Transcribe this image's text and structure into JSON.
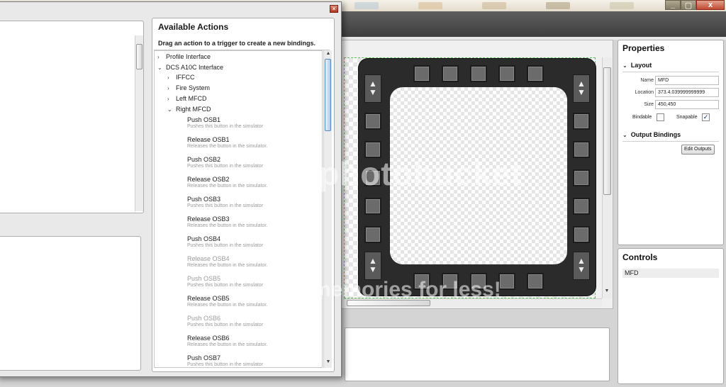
{
  "window": {
    "controls": [
      "_",
      "▢",
      "x"
    ]
  },
  "available_actions": {
    "title": "Available Actions",
    "hint": "Drag an action to a trigger to create a new bindings.",
    "tree": [
      {
        "label": "Profile Interface",
        "expanded": false
      },
      {
        "label": "DCS A10C Interface",
        "expanded": true
      },
      {
        "label": "IFFCC",
        "expanded": false
      },
      {
        "label": "Fire System",
        "expanded": false
      },
      {
        "label": "Left MFCD",
        "expanded": false
      },
      {
        "label": "Right MFCD",
        "expanded": true
      }
    ],
    "actions": [
      {
        "name": "Push OSB1",
        "desc": "Pushes this button in the simulator"
      },
      {
        "name": "Release OSB1",
        "desc": "Releases the button in the simulator."
      },
      {
        "name": "Push OSB2",
        "desc": "Pushes this button in the simulator"
      },
      {
        "name": "Release OSB2",
        "desc": "Releases the button in the simulator."
      },
      {
        "name": "Push OSB3",
        "desc": "Pushes this button in the simulator"
      },
      {
        "name": "Release OSB3",
        "desc": "Releases the button in the simulator."
      },
      {
        "name": "Push OSB4",
        "desc": "Pushes this button in the simulator"
      },
      {
        "name": "Release OSB4",
        "desc": "Releases the button in the simulator."
      },
      {
        "name": "Push OSB5",
        "desc": "Pushes this button in the simulator"
      },
      {
        "name": "Release OSB5",
        "desc": "Releases the button in the simulator."
      },
      {
        "name": "Push OSB6",
        "desc": "Pushes this button in the simulator"
      },
      {
        "name": "Release OSB6",
        "desc": "Releases the button in the simulator."
      },
      {
        "name": "Push OSB7",
        "desc": "Pushes this button in the simulator"
      }
    ]
  },
  "properties": {
    "title": "Properties",
    "layout_section": "Layout",
    "name_label": "Name",
    "name_value": "MFD",
    "location_label": "Location",
    "location_value": "373.4.039999999999",
    "size_label": "Size",
    "size_value": "450,450",
    "bindable_label": "Bindable",
    "bindable_checked": false,
    "snapable_label": "Snapable",
    "snapable_checked": true,
    "output_section": "Output Bindings",
    "edit_outputs_label": "Edit Outputs"
  },
  "controls_panel": {
    "title": "Controls",
    "items": [
      "MFD"
    ]
  },
  "watermark": {
    "line1": "photobucket",
    "line2": "memories for less!"
  },
  "colors": {
    "accent_selection": "#5ac15a",
    "mfd_body": "#2b2b2b"
  }
}
